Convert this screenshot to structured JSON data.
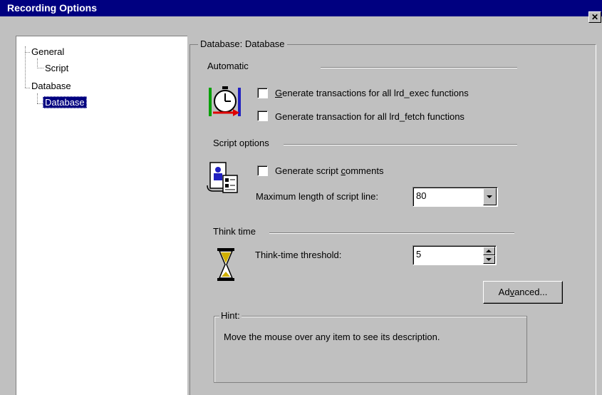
{
  "window": {
    "title": "Recording Options",
    "close_glyph": "✕"
  },
  "tree": {
    "items": [
      {
        "label": "General"
      },
      {
        "label": "Script"
      },
      {
        "label": "Database"
      },
      {
        "label": "Database",
        "selected": true
      }
    ]
  },
  "panel": {
    "title": "Database: Database",
    "automatic": {
      "label": "Automatic",
      "icon": "stopwatch-transaction-icon",
      "options": [
        {
          "prefix": "G",
          "rest": "enerate transactions for all lrd_exec functions",
          "checked": false
        },
        {
          "label": "Generate transaction for all lrd_fetch functions",
          "checked": false
        }
      ]
    },
    "script_options": {
      "label": "Script options",
      "icon": "script-document-icon",
      "comments": {
        "before": "Generate script ",
        "key": "c",
        "after": "omments",
        "checked": false
      },
      "max_length": {
        "label": "Maximum length of script line:",
        "value": "80"
      }
    },
    "think_time": {
      "label": "Think time",
      "icon": "hourglass-icon",
      "threshold": {
        "label": "Think-time threshold:",
        "value": "5"
      }
    },
    "advanced_button": {
      "before": "Ad",
      "key": "v",
      "after": "anced..."
    },
    "hint": {
      "label": "Hint:",
      "text": "Move the mouse over any item to see its description."
    }
  },
  "colors": {
    "titlebar": "#000080",
    "face": "#c0c0c0",
    "selection": "#000080"
  }
}
